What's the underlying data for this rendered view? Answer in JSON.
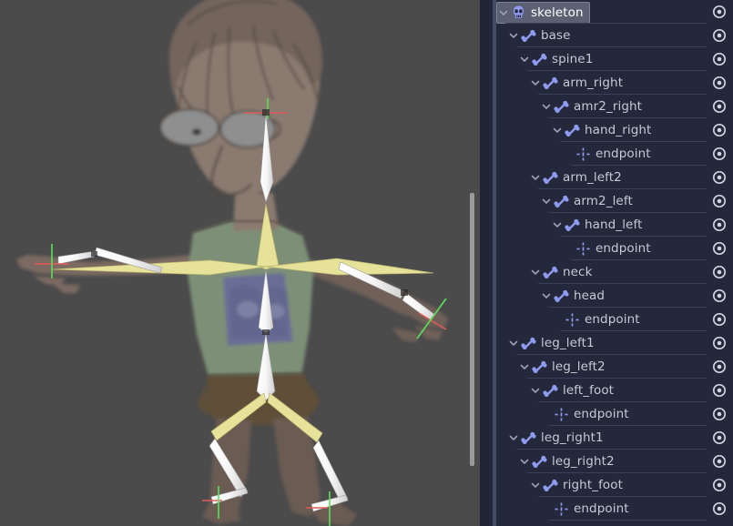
{
  "app": {
    "panel_bg": "#23283a",
    "viewport_bg": "#4b4b4b",
    "selection_color": "#5b6173",
    "bone_icon_color": "#8f9bf0",
    "selected_bone_color": "#e8e49a",
    "unselected_bone_color": "#f2f2f2"
  },
  "viewport": {
    "name": "2d-canvas-viewport",
    "scrollbar_present": true
  },
  "tree": {
    "name": "skeleton-bone-tree",
    "rows": [
      {
        "label": "skeleton",
        "depth": 0,
        "icon": "skull-icon",
        "caret": true,
        "selected": true,
        "eye": "visibility-eye-icon"
      },
      {
        "label": "base",
        "depth": 1,
        "icon": "bone-icon",
        "caret": true,
        "selected": false,
        "eye": "visibility-eye-icon"
      },
      {
        "label": "spine1",
        "depth": 2,
        "icon": "bone-icon",
        "caret": true,
        "selected": false,
        "eye": "visibility-eye-icon"
      },
      {
        "label": "arm_right",
        "depth": 3,
        "icon": "bone-icon",
        "caret": true,
        "selected": false,
        "eye": "visibility-eye-icon"
      },
      {
        "label": "amr2_right",
        "depth": 4,
        "icon": "bone-icon",
        "caret": true,
        "selected": false,
        "eye": "visibility-eye-icon"
      },
      {
        "label": "hand_right",
        "depth": 5,
        "icon": "bone-icon",
        "caret": true,
        "selected": false,
        "eye": "visibility-eye-icon"
      },
      {
        "label": "endpoint",
        "depth": 6,
        "icon": "endpoint-icon",
        "caret": false,
        "selected": false,
        "eye": "visibility-eye-icon"
      },
      {
        "label": "arm_left2",
        "depth": 3,
        "icon": "bone-icon",
        "caret": true,
        "selected": false,
        "eye": "visibility-eye-icon"
      },
      {
        "label": "arm2_left",
        "depth": 4,
        "icon": "bone-icon",
        "caret": true,
        "selected": false,
        "eye": "visibility-eye-icon"
      },
      {
        "label": "hand_left",
        "depth": 5,
        "icon": "bone-icon",
        "caret": true,
        "selected": false,
        "eye": "visibility-eye-icon"
      },
      {
        "label": "endpoint",
        "depth": 6,
        "icon": "endpoint-icon",
        "caret": false,
        "selected": false,
        "eye": "visibility-eye-icon"
      },
      {
        "label": "neck",
        "depth": 3,
        "icon": "bone-icon",
        "caret": true,
        "selected": false,
        "eye": "visibility-eye-icon"
      },
      {
        "label": "head",
        "depth": 4,
        "icon": "bone-icon",
        "caret": true,
        "selected": false,
        "eye": "visibility-eye-icon"
      },
      {
        "label": "endpoint",
        "depth": 5,
        "icon": "endpoint-icon",
        "caret": false,
        "selected": false,
        "eye": "visibility-eye-icon"
      },
      {
        "label": "leg_left1",
        "depth": 1,
        "icon": "bone-icon",
        "caret": true,
        "selected": false,
        "eye": "visibility-eye-icon"
      },
      {
        "label": "leg_left2",
        "depth": 2,
        "icon": "bone-icon",
        "caret": true,
        "selected": false,
        "eye": "visibility-eye-icon"
      },
      {
        "label": "left_foot",
        "depth": 3,
        "icon": "bone-icon",
        "caret": true,
        "selected": false,
        "eye": "visibility-eye-icon"
      },
      {
        "label": "endpoint",
        "depth": 4,
        "icon": "endpoint-icon",
        "caret": false,
        "selected": false,
        "eye": "visibility-eye-icon"
      },
      {
        "label": "leg_right1",
        "depth": 1,
        "icon": "bone-icon",
        "caret": true,
        "selected": false,
        "eye": "visibility-eye-icon"
      },
      {
        "label": "leg_right2",
        "depth": 2,
        "icon": "bone-icon",
        "caret": true,
        "selected": false,
        "eye": "visibility-eye-icon"
      },
      {
        "label": "right_foot",
        "depth": 3,
        "icon": "bone-icon",
        "caret": true,
        "selected": false,
        "eye": "visibility-eye-icon"
      },
      {
        "label": "endpoint",
        "depth": 4,
        "icon": "endpoint-icon",
        "caret": false,
        "selected": false,
        "eye": "visibility-eye-icon"
      }
    ]
  }
}
